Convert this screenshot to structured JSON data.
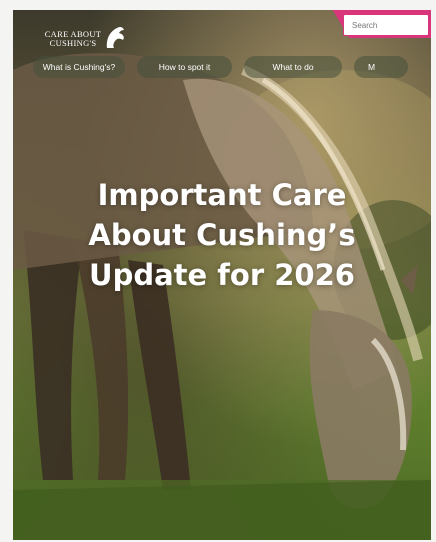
{
  "header": {
    "logo_line1": "CARE ABOUT",
    "logo_line2": "CUSHING'S",
    "search_placeholder": "Search"
  },
  "nav": {
    "items": [
      {
        "label": "What is Cushing's?"
      },
      {
        "label": "How to spot it"
      },
      {
        "label": "What to do"
      },
      {
        "label": "M"
      }
    ]
  },
  "hero": {
    "headline_line1": "Important Care",
    "headline_line2": "About Cushing’s",
    "headline_line3": "Update for 2026",
    "image_subject": "grazing-horse-photo"
  },
  "colors": {
    "accent_pink": "#d8357a",
    "text_white": "#ffffff"
  }
}
